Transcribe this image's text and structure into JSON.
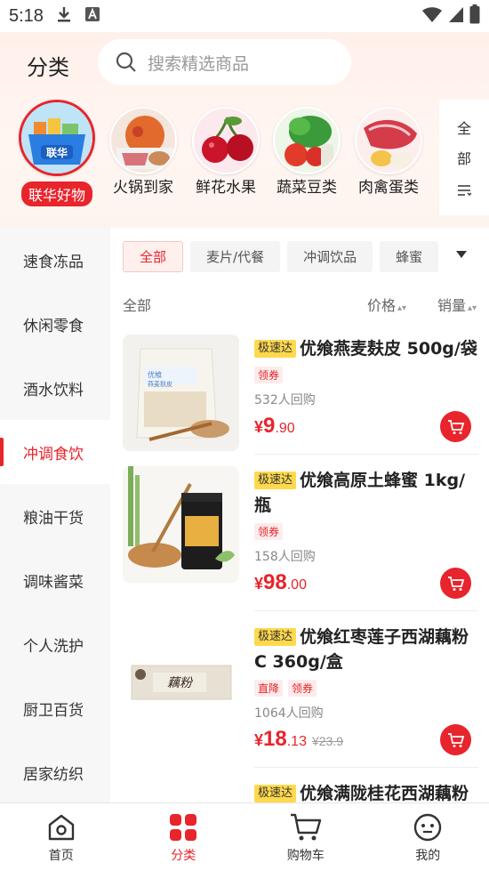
{
  "status_bar": {
    "time": "5:18"
  },
  "header": {
    "title": "分类",
    "search_placeholder": "搜索精选商品"
  },
  "categories": [
    {
      "label": "联华好物",
      "active": true,
      "icon": "lianhua-basket-image"
    },
    {
      "label": "火锅到家",
      "active": false,
      "icon": "hotpot-image"
    },
    {
      "label": "鲜花水果",
      "active": false,
      "icon": "cherries-image"
    },
    {
      "label": "蔬菜豆类",
      "active": false,
      "icon": "vegetables-image"
    },
    {
      "label": "肉禽蛋类",
      "active": false,
      "icon": "meat-egg-image"
    }
  ],
  "all_toggle": {
    "chars": [
      "全",
      "部"
    ],
    "icon": "filter-list-icon"
  },
  "sidebar": {
    "items": [
      {
        "label": "速食冻品",
        "active": false
      },
      {
        "label": "休闲零食",
        "active": false
      },
      {
        "label": "酒水饮料",
        "active": false
      },
      {
        "label": "冲调食饮",
        "active": true
      },
      {
        "label": "粮油干货",
        "active": false
      },
      {
        "label": "调味酱菜",
        "active": false
      },
      {
        "label": "个人洗护",
        "active": false
      },
      {
        "label": "厨卫百货",
        "active": false
      },
      {
        "label": "居家纺织",
        "active": false
      }
    ]
  },
  "filters": {
    "chips": [
      {
        "label": "全部",
        "active": true
      },
      {
        "label": "麦片/代餐",
        "active": false
      },
      {
        "label": "冲调饮品",
        "active": false
      },
      {
        "label": "蜂蜜",
        "active": false
      }
    ],
    "more_icon": "triangle-down-icon"
  },
  "sort": {
    "all": "全部",
    "price": "价格",
    "sales": "销量"
  },
  "products": [
    {
      "badge": "极速达",
      "title": "优飨燕麦麸皮 500g/袋",
      "tags": [
        "领券"
      ],
      "buyers": "532人回购",
      "price_symbol": "¥",
      "price_int": "9",
      "price_dec": ".90",
      "orig_price": ""
    },
    {
      "badge": "极速达",
      "title": "优飨高原土蜂蜜 1kg/瓶",
      "tags": [
        "领券"
      ],
      "buyers": "158人回购",
      "price_symbol": "¥",
      "price_int": "98",
      "price_dec": ".00",
      "orig_price": ""
    },
    {
      "badge": "极速达",
      "title": "优飨红枣莲子西湖藕粉C 360g/盒",
      "tags": [
        "直降",
        "领券"
      ],
      "buyers": "1064人回购",
      "price_symbol": "¥",
      "price_int": "18",
      "price_dec": ".13",
      "orig_price": "¥23.9"
    },
    {
      "badge": "极速达",
      "title": "优飨满陇桂花西湖藕粉",
      "tags": [],
      "buyers": "",
      "price_symbol": "",
      "price_int": "",
      "price_dec": "",
      "orig_price": ""
    }
  ],
  "bottom_nav": [
    {
      "label": "首页",
      "icon": "home-icon",
      "active": false
    },
    {
      "label": "分类",
      "icon": "category-grid-icon",
      "active": true
    },
    {
      "label": "购物车",
      "icon": "cart-icon",
      "active": false
    },
    {
      "label": "我的",
      "icon": "profile-face-icon",
      "active": false
    }
  ],
  "colors": {
    "accent": "#e8242c",
    "fast_badge": "#ffd94d"
  }
}
